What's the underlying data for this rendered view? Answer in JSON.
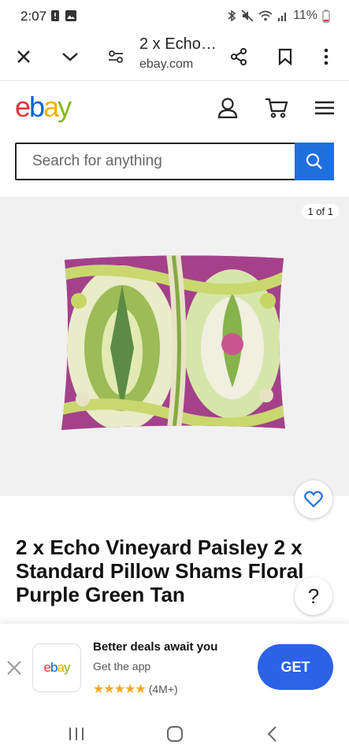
{
  "status": {
    "time": "2:07",
    "battery": "11%"
  },
  "browser": {
    "title": "2 x Echo…",
    "host": "ebay.com"
  },
  "ebay": {
    "search_placeholder": "Search for anything"
  },
  "gallery": {
    "counter": "1 of 1"
  },
  "product": {
    "title": "2 x Echo Vineyard Paisley 2 x Standard Pillow Shams Floral Purple Green Tan"
  },
  "help_label": "?",
  "banner": {
    "app_logo": "ebay",
    "headline": "Better deals await you",
    "subline": "Get the app",
    "stars": "★★★★★",
    "rating_count": "(4M+)",
    "get_label": "GET"
  },
  "colors": {
    "blue": "#1f6fdf",
    "get_blue": "#2b62e8",
    "ebay_e": "#e53238",
    "ebay_b": "#0064d2",
    "ebay_a": "#f5af02",
    "ebay_y": "#86b817"
  }
}
